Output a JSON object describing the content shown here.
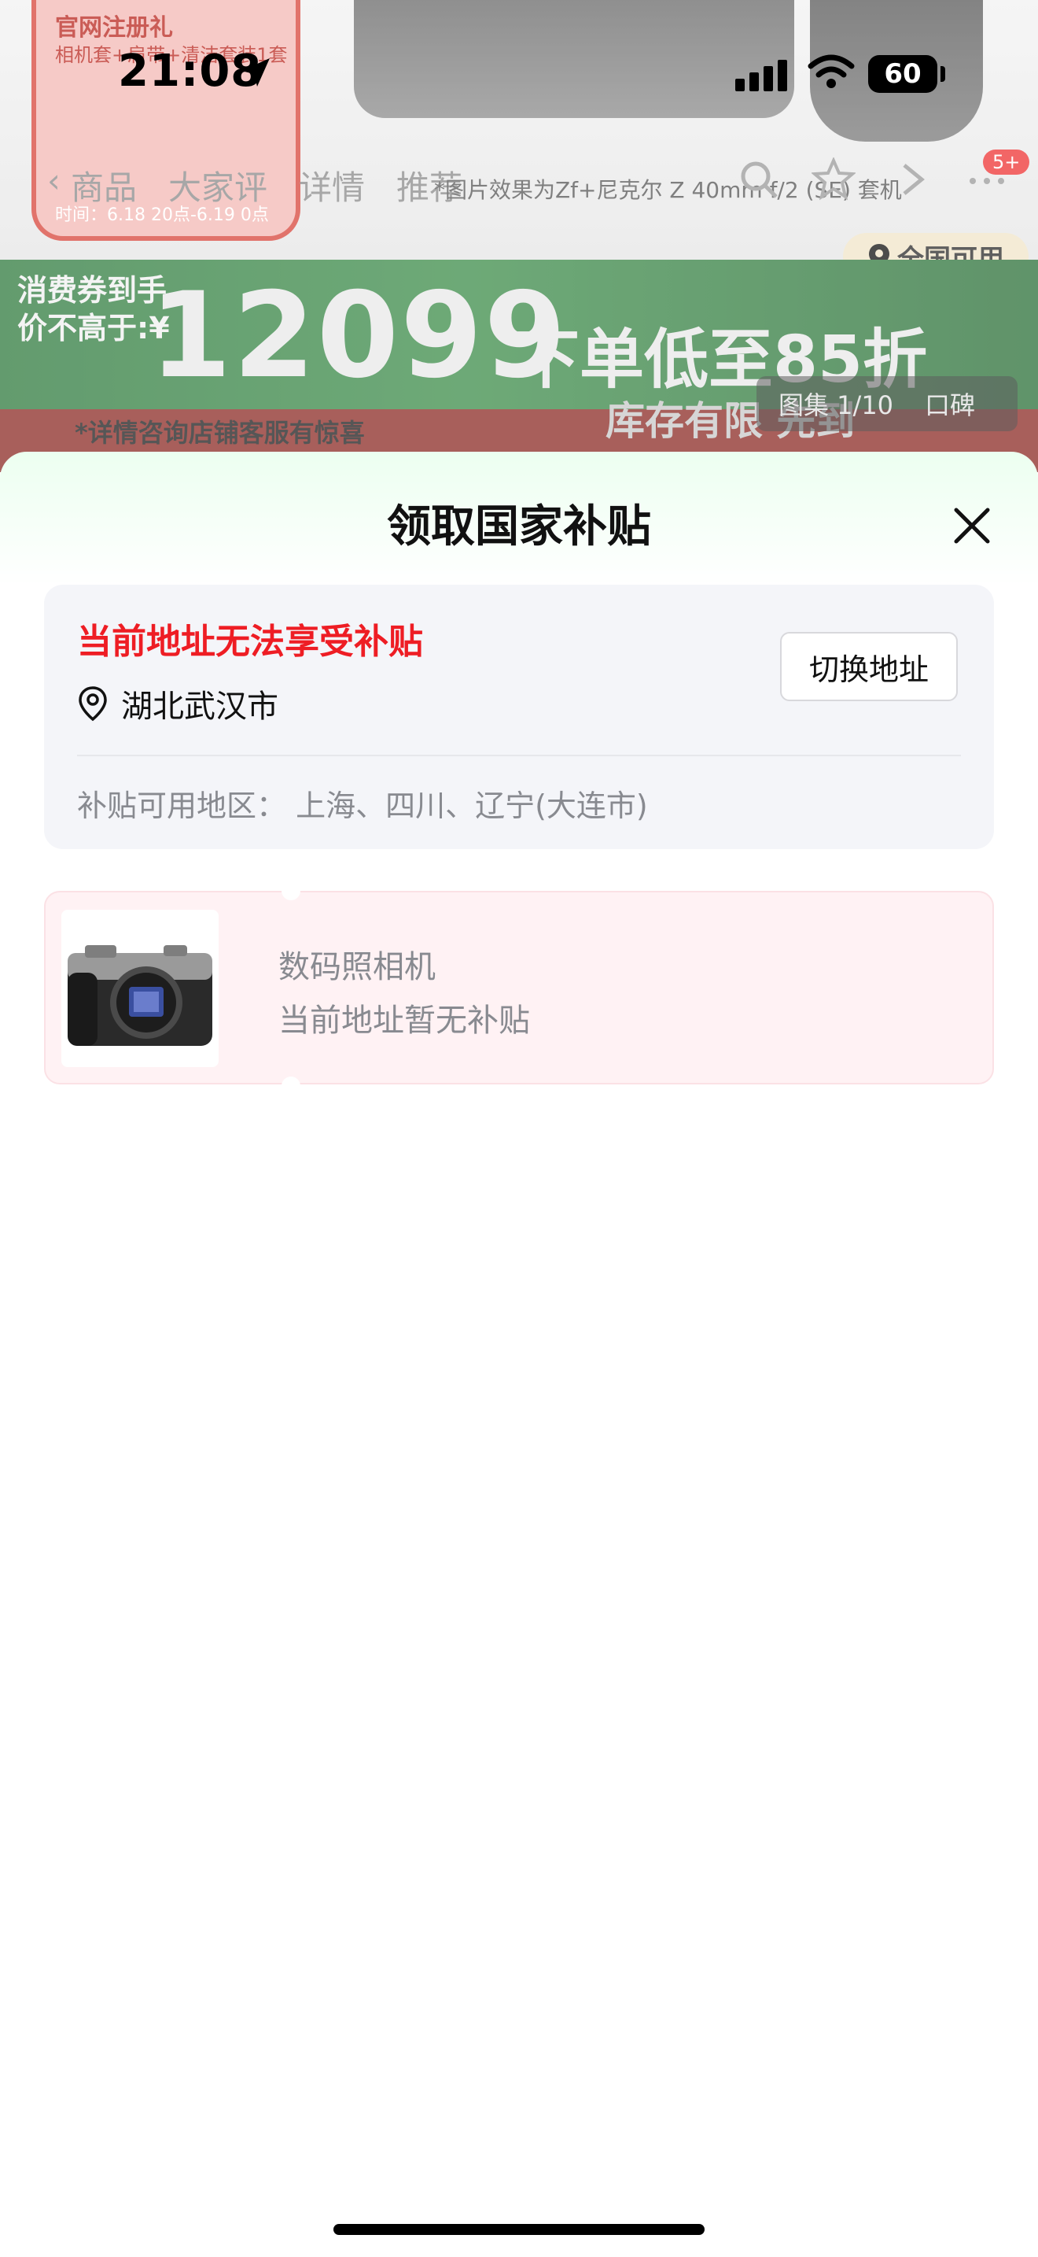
{
  "status_bar": {
    "time": "21:08",
    "battery": "60",
    "icons": [
      "location-arrow-icon",
      "cellular-signal-icon",
      "wifi-icon",
      "battery-icon"
    ]
  },
  "background_page": {
    "back_icon": "‹",
    "tabs": [
      "商品",
      "大家评",
      "详情",
      "推荐"
    ],
    "preview_note": "*图片效果为Zf+尼克尔 Z 40mm f/2 (SE) 套机",
    "promo_card": {
      "title": "官网注册礼",
      "subtitle": "相机套+肩带+清洁套装1套",
      "date": "时间：6.18 20点-6.19 0点"
    },
    "region_chip": "全国可用",
    "banner": {
      "label": "消费券到手价不高于:¥",
      "price": "12099",
      "discount": "下单低至85折",
      "stock": "库存有限 先到",
      "note": "*详情咨询店铺客服有惊喜"
    },
    "gallery": {
      "counter": "图集 1/10",
      "reviews": "口碑"
    },
    "cart_badge": "5+"
  },
  "sheet": {
    "title": "领取国家补贴",
    "close_icon": "close-icon",
    "address": {
      "warning": "当前地址无法享受补贴",
      "location": "湖北武汉市",
      "switch_label": "切换地址",
      "regions": "补贴可用地区：  上海、四川、辽宁(大连市)"
    },
    "product": {
      "name": "数码照相机",
      "status": "当前地址暂无补贴"
    }
  },
  "colors": {
    "warning_red": "#ee1d24",
    "card_bg": "#f4f5f9",
    "product_card_bg": "#fff2f4",
    "muted_text": "#888a90",
    "banner_green": "#2f7a3e"
  }
}
